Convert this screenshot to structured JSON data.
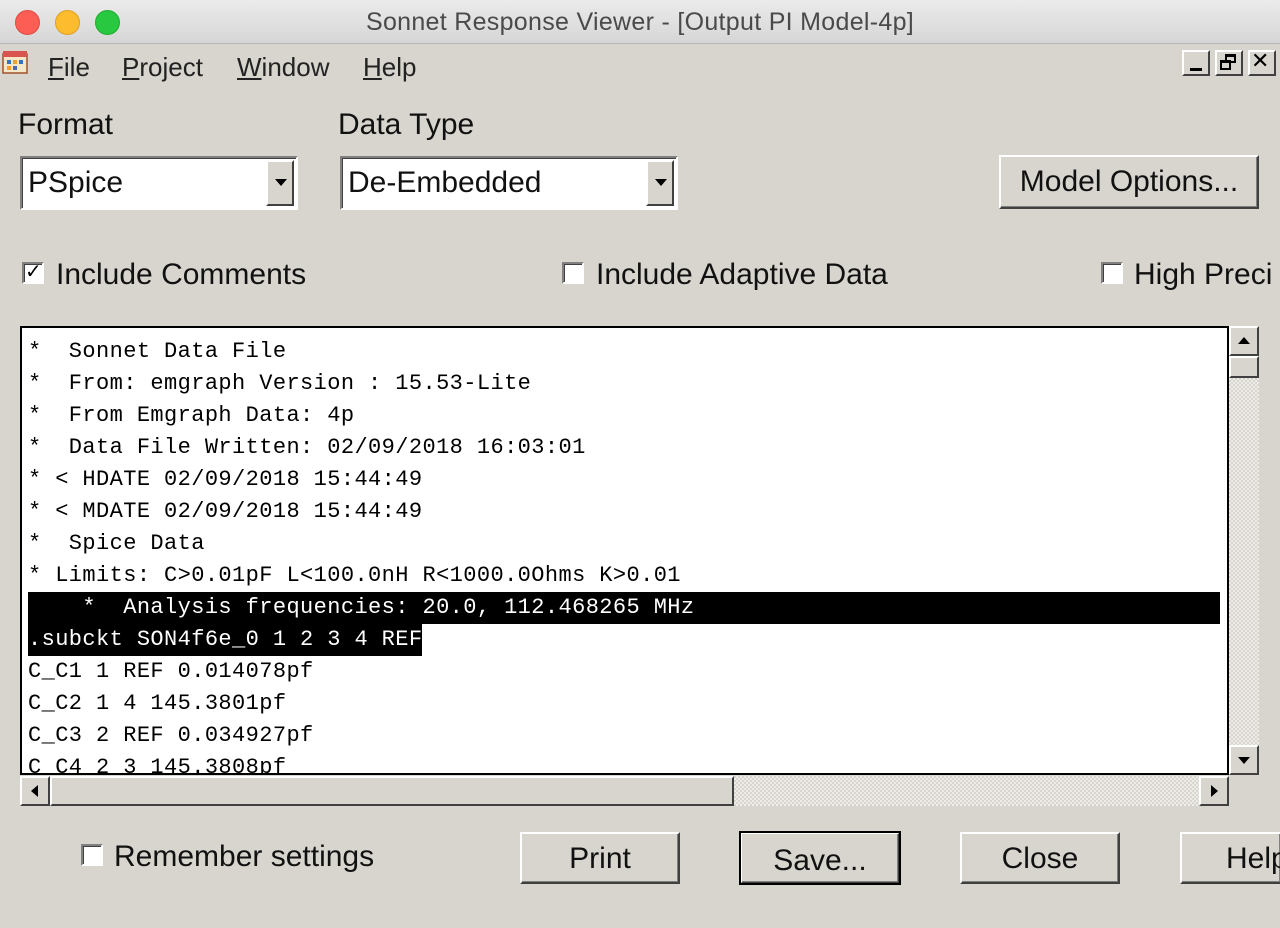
{
  "window": {
    "title": "Sonnet Response Viewer - [Output PI Model-4p]"
  },
  "menu": {
    "items": [
      {
        "label": "File"
      },
      {
        "label": "Project"
      },
      {
        "label": "Window"
      },
      {
        "label": "Help"
      }
    ]
  },
  "format": {
    "label": "Format",
    "value": "PSpice"
  },
  "data_type": {
    "label": "Data Type",
    "value": "De-Embedded"
  },
  "model_options_button": "Model Options...",
  "options": {
    "include_comments": {
      "label": "Include Comments",
      "checked": true
    },
    "include_adaptive": {
      "label": "Include Adaptive Data",
      "checked": false
    },
    "high_precision": {
      "label": "High Preci",
      "checked": false
    }
  },
  "output_lines": [
    "*  Sonnet Data File",
    "*  From: emgraph Version : 15.53-Lite",
    "*  From Emgraph Data: 4p",
    "*  Data File Written: 02/09/2018 16:03:01",
    "* < HDATE 02/09/2018 15:44:49",
    "* < MDATE 02/09/2018 15:44:49",
    "*  Spice Data",
    "* Limits: C>0.01pF L<100.0nH R<1000.0Ohms K>0.01",
    "    *  Analysis frequencies: 20.0, 112.468265 MHz",
    ".subckt SON4f6e_0 1 2 3 4 REF",
    "C_C1 1 REF 0.014078pf",
    "C_C2 1 4 145.3801pf",
    "C_C3 2 REF 0.034927pf",
    "C_C4 2 3 145.3808pf"
  ],
  "remember_settings": {
    "label": "Remember settings",
    "checked": false
  },
  "buttons": {
    "print": "Print",
    "save": "Save...",
    "close": "Close",
    "help": "Help"
  },
  "icons": {
    "app": "sonnet-app-icon",
    "minimize": "minimize-icon",
    "restore": "restore-icon",
    "close": "close-icon"
  }
}
